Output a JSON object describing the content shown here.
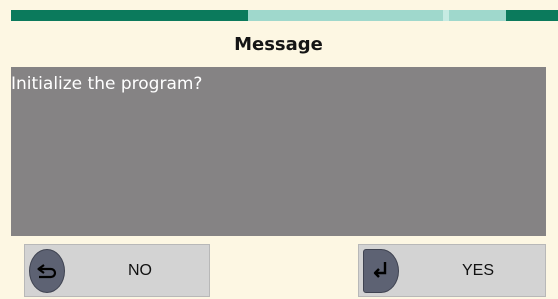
{
  "colors": {
    "background": "#fdf7e3",
    "progress_dark": "#0b7a5c",
    "progress_light": "#9fd8cc",
    "message_area": "#858384",
    "button_bg": "#d3d3d3",
    "button_icon_bg": "#5d6273"
  },
  "dialog": {
    "title": "Message",
    "message": "Initialize the program?"
  },
  "buttons": {
    "no": {
      "label": "NO",
      "icon": "return-back-icon"
    },
    "yes": {
      "label": "YES",
      "icon": "enter-icon"
    }
  }
}
